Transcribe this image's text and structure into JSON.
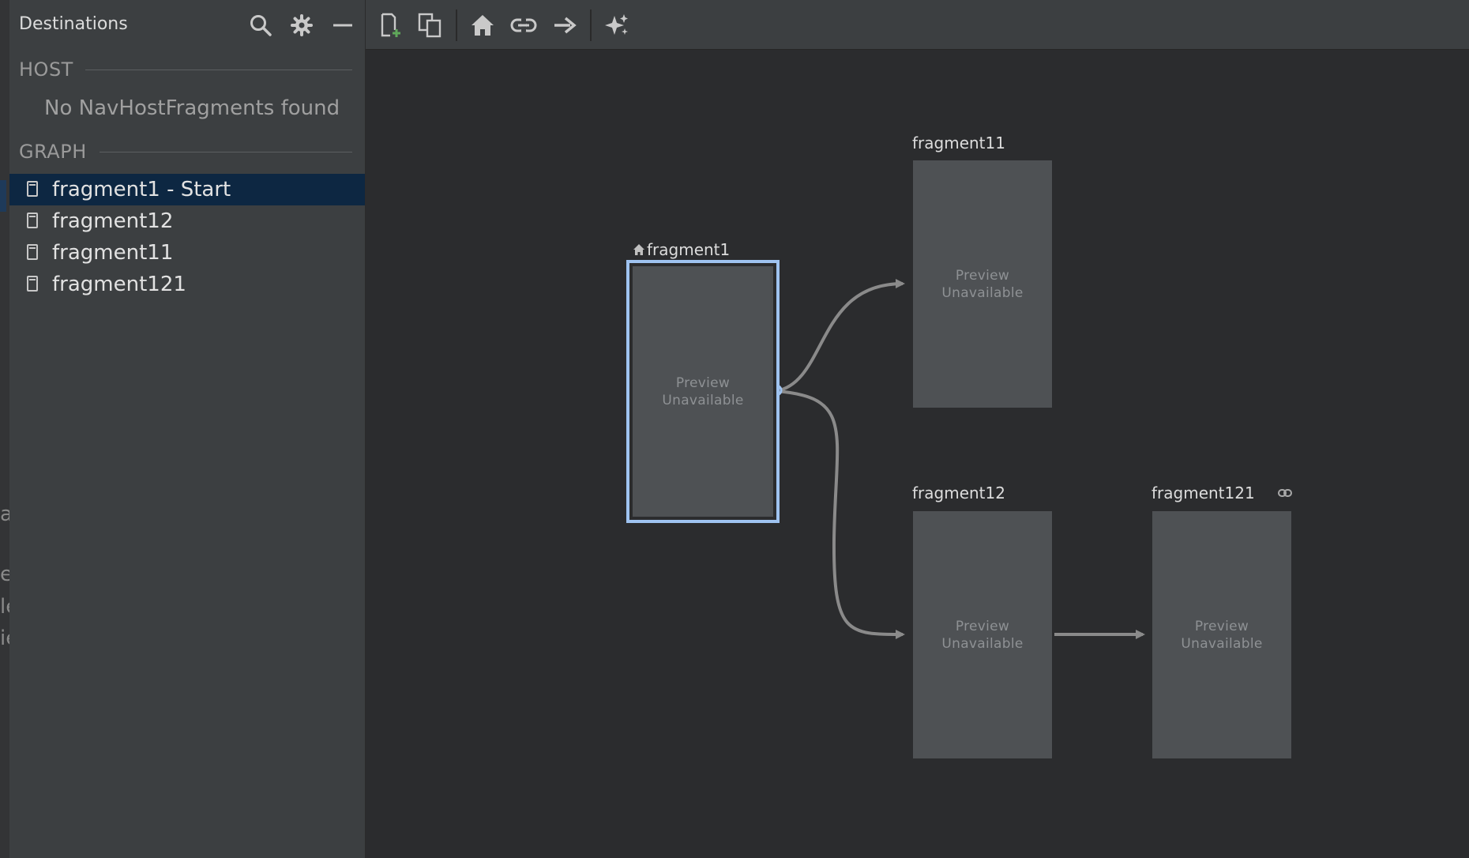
{
  "sidebar": {
    "title": "Destinations",
    "host_section": "HOST",
    "host_empty": "No NavHostFragments found",
    "graph_section": "GRAPH",
    "items": [
      {
        "label": "fragment1 - Start",
        "selected": true
      },
      {
        "label": "fragment12",
        "selected": false
      },
      {
        "label": "fragment11",
        "selected": false
      },
      {
        "label": "fragment121",
        "selected": false
      }
    ]
  },
  "gutter_fragments": [
    "a",
    "e",
    "le",
    "ie"
  ],
  "toolbar": {
    "icons": [
      "new-destination-icon",
      "nested-graph-icon",
      "start-destination-icon",
      "deep-link-icon",
      "action-icon",
      "auto-arrange-icon"
    ]
  },
  "graph": {
    "preview_line1": "Preview",
    "preview_line2": "Unavailable",
    "destinations": [
      {
        "id": "fragment1",
        "label": "fragment1",
        "start": true,
        "selected": true
      },
      {
        "id": "fragment11",
        "label": "fragment11"
      },
      {
        "id": "fragment12",
        "label": "fragment12"
      },
      {
        "id": "fragment121",
        "label": "fragment121",
        "deep_link": true
      }
    ],
    "actions": [
      {
        "from": "fragment1",
        "to": "fragment11"
      },
      {
        "from": "fragment1",
        "to": "fragment12"
      },
      {
        "from": "fragment12",
        "to": "fragment121"
      }
    ]
  },
  "colors": {
    "selection_border": "#9fc3f0",
    "selected_row": "#0d2742",
    "action_line": "#8a8a8a",
    "add_accent": "#5fa85a"
  }
}
